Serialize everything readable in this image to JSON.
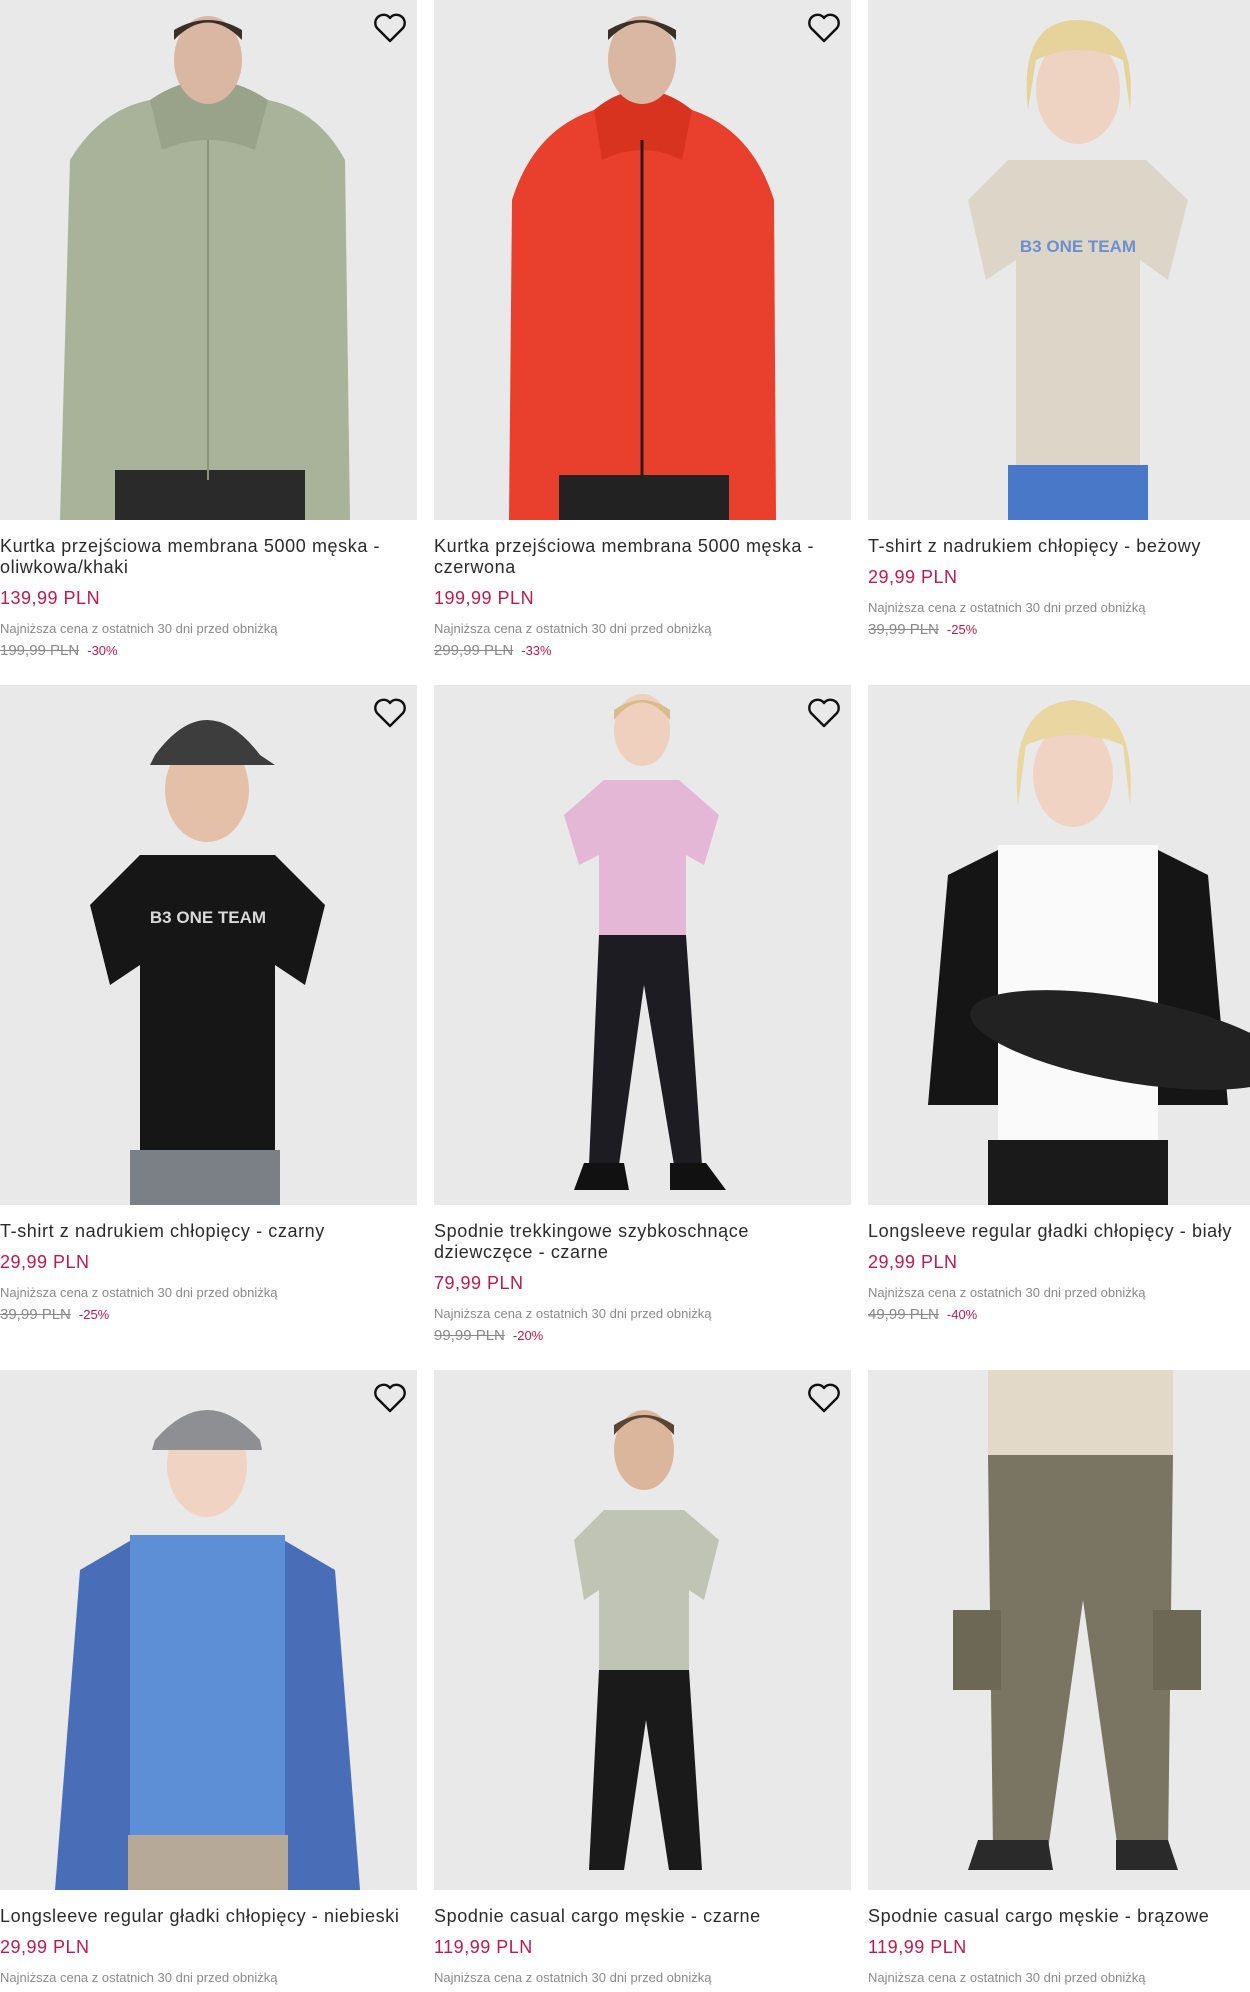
{
  "products": [
    {
      "name": "Kurtka przejściowa membrana 5000 męska - oliwkowa/khaki",
      "price": "139,99 PLN",
      "lowest_label": "Najniższa cena z ostatnich 30 dni przed obniżką",
      "old_price": "199,99 PLN",
      "discount": "-30%",
      "image": "man-olive-jacket",
      "colors": {
        "bg": "#e9e9ea",
        "garment": "#a9b39a",
        "pants": "#2a2a2a"
      }
    },
    {
      "name": "Kurtka przejściowa membrana 5000 męska - czerwona",
      "price": "199,99 PLN",
      "lowest_label": "Najniższa cena z ostatnich 30 dni przed obniżką",
      "old_price": "299,99 PLN",
      "discount": "-33%",
      "image": "man-red-jacket",
      "colors": {
        "bg": "#e9e9ea",
        "garment": "#e8402c",
        "pants": "#222222"
      }
    },
    {
      "name": "T-shirt z nadrukiem chłopięcy - beżowy",
      "price": "29,99 PLN",
      "lowest_label": "Najniższa cena z ostatnich 30 dni przed obniżką",
      "old_price": "39,99 PLN",
      "discount": "-25%",
      "image": "boy-beige-tshirt",
      "print": "B3 ONE TEAM",
      "colors": {
        "bg": "#e9e9ea",
        "garment": "#ddd6c8",
        "pants": "#4a78c9"
      }
    },
    {
      "name": "T-shirt z nadrukiem chłopięcy - czarny",
      "price": "29,99 PLN",
      "lowest_label": "Najniższa cena z ostatnich 30 dni przed obniżką",
      "old_price": "39,99 PLN",
      "discount": "-25%",
      "image": "boy-black-tshirt",
      "print": "B3 ONE TEAM",
      "colors": {
        "bg": "#e9e9ea",
        "garment": "#161616",
        "pants": "#7b7f86"
      }
    },
    {
      "name": "Spodnie trekkingowe szybkoschnące dziewczęce - czarne",
      "price": "79,99 PLN",
      "lowest_label": "Najniższa cena z ostatnich 30 dni przed obniżką",
      "old_price": "99,99 PLN",
      "discount": "-20%",
      "image": "girl-black-pants",
      "colors": {
        "bg": "#e9e9ea",
        "garment": "#e4b7d7",
        "pants": "#1c1c22"
      }
    },
    {
      "name": "Longsleeve regular gładki chłopięcy - biały",
      "price": "29,99 PLN",
      "lowest_label": "Najniższa cena z ostatnich 30 dni przed obniżką",
      "old_price": "49,99 PLN",
      "discount": "-40%",
      "image": "boy-white-longsleeve",
      "colors": {
        "bg": "#e9e9ea",
        "garment": "#fafafa",
        "sleeves": "#151515",
        "pants": "#1a1a1a"
      }
    },
    {
      "name": "Longsleeve regular gładki chłopięcy - niebieski",
      "price": "29,99 PLN",
      "lowest_label": "Najniższa cena z ostatnich 30 dni przed obniżką",
      "image": "boy-blue-longsleeve",
      "colors": {
        "bg": "#e9e9ea",
        "garment": "#5d8fd6",
        "sleeves": "#4a6db8",
        "pants": "#b7a998"
      }
    },
    {
      "name": "Spodnie casual cargo męskie - czarne",
      "price": "119,99 PLN",
      "lowest_label": "Najniższa cena z ostatnich 30 dni przed obniżką",
      "image": "man-black-cargo",
      "colors": {
        "bg": "#e9e9ea",
        "garment": "#bfc4b5",
        "pants": "#1a1a1a"
      }
    },
    {
      "name": "Spodnie casual cargo męskie - brązowe",
      "price": "119,99 PLN",
      "lowest_label": "Najniższa cena z ostatnich 30 dni przed obniżką",
      "image": "man-brown-cargo",
      "colors": {
        "bg": "#e9e9ea",
        "garment": "#e2d9c9",
        "pants": "#7a7462"
      }
    }
  ]
}
